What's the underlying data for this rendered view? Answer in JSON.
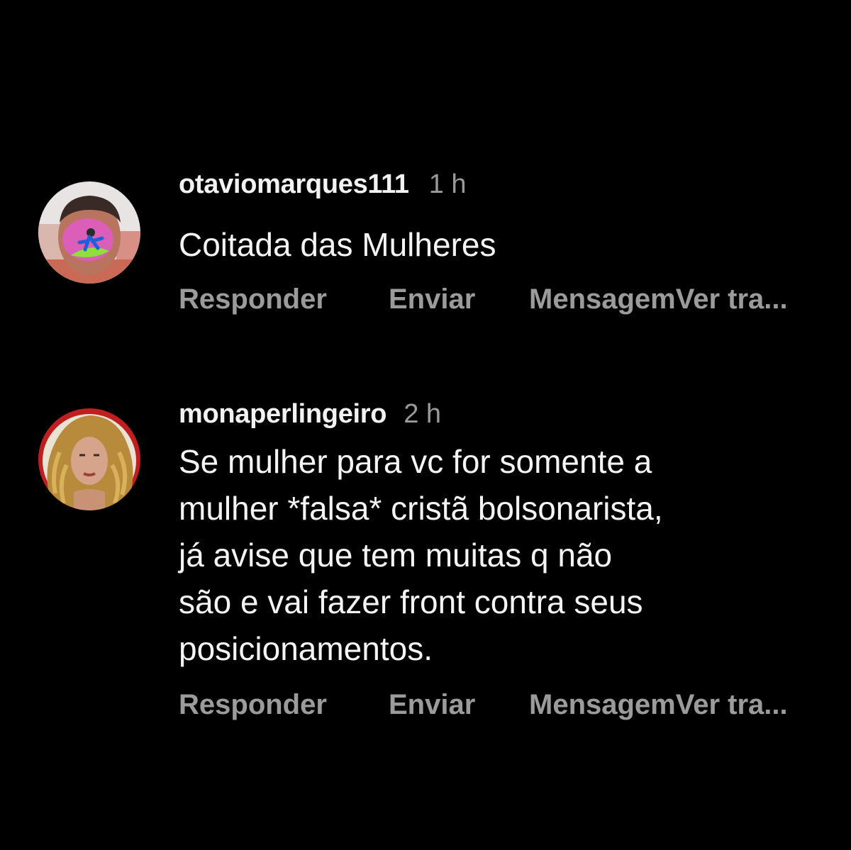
{
  "comments": [
    {
      "username": "otaviomarques111",
      "time": "1 h",
      "text": "Coitada das Mulheres",
      "actions": {
        "reply": "Responder",
        "send": "Enviar",
        "message_translate": "MensagemVer tra..."
      }
    },
    {
      "username": "monaperlingeiro",
      "time": "2 h",
      "text": "Se mulher para vc for somente a\nmulher *falsa* cristã bolsonarista,\njá avise que tem muitas q não\nsão e vai fazer front contra seus\nposicionamentos.",
      "actions": {
        "reply": "Responder",
        "send": "Enviar",
        "message_translate": "MensagemVer tra..."
      }
    }
  ]
}
